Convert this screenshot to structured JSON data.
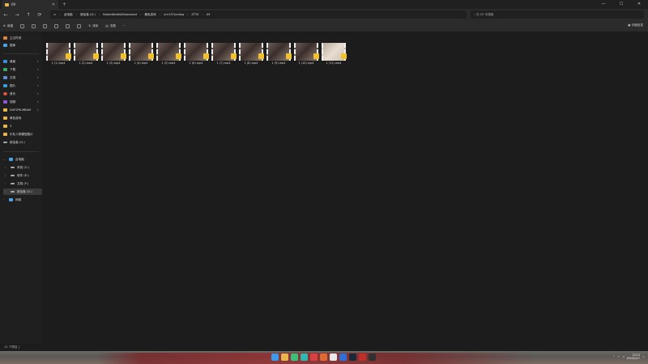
{
  "window": {
    "tab_title": "09",
    "new_tab": "+",
    "controls": [
      "—",
      "☐",
      "✕"
    ]
  },
  "nav": {
    "back": "←",
    "forward": "→",
    "up": "↑",
    "refresh": "⟳"
  },
  "breadcrumb": [
    "此电脑",
    "新加卷 (G:)",
    "BaiduNetdiskDownload",
    "黄色游戏",
    "uhr197yndwg",
    "ZTT4",
    "09"
  ],
  "search": {
    "placeholder": "在 09 中搜索"
  },
  "toolbar": {
    "new_label": "新建",
    "sort_label": "排序",
    "view_label": "查看",
    "more_label": "···",
    "details_label": "详细信息"
  },
  "sidebar": {
    "quick": [
      {
        "label": "主文件夹",
        "icon": "home-icon",
        "color": "#e0833e"
      },
      {
        "label": "图库",
        "icon": "gallery-icon",
        "color": "#4aa3e8"
      }
    ],
    "pinned": [
      {
        "label": "桌面",
        "icon": "desktop-icon",
        "color": "#3b8fd9"
      },
      {
        "label": "下载",
        "icon": "download-icon",
        "color": "#3aa86a"
      },
      {
        "label": "文档",
        "icon": "document-icon",
        "color": "#5a8fd6"
      },
      {
        "label": "图片",
        "icon": "picture-icon",
        "color": "#3b9bd9"
      },
      {
        "label": "音乐",
        "icon": "music-icon",
        "color": "#e0553e"
      },
      {
        "label": "视频",
        "icon": "video-icon",
        "color": "#8b5ad6"
      },
      {
        "label": "DXFSPK-MRAM",
        "icon": "folder-icon",
        "color": "#e8b64c"
      },
      {
        "label": "黄色游戏",
        "icon": "folder-icon",
        "color": "#e8b64c"
      },
      {
        "label": "3",
        "icon": "folder-icon",
        "color": "#e8b64c"
      },
      {
        "label": "乐队人物模型图片",
        "icon": "folder-icon",
        "color": "#e8b64c"
      },
      {
        "label": "新加卷 (G:)",
        "icon": "drive-icon",
        "color": "#aaaaaa"
      }
    ],
    "this_pc": {
      "label": "此电脑",
      "icon": "computer-icon",
      "color": "#4aa3e8"
    },
    "drives": [
      {
        "label": "系统 (C:)",
        "icon": "drive-icon"
      },
      {
        "label": "软件 (E:)",
        "icon": "drive-icon"
      },
      {
        "label": "文档 (F:)",
        "icon": "drive-icon"
      },
      {
        "label": "新加卷 (G:)",
        "icon": "drive-icon"
      }
    ],
    "network": {
      "label": "网络",
      "icon": "network-icon",
      "color": "#4aa3e8"
    }
  },
  "files": [
    {
      "name": "1 (1).mp4",
      "thumb": "dark"
    },
    {
      "name": "1 (2).mp4",
      "thumb": "dark"
    },
    {
      "name": "1 (3).mp4",
      "thumb": "dark"
    },
    {
      "name": "1 (4).mp4",
      "thumb": "dark"
    },
    {
      "name": "1 (5).mp4",
      "thumb": "dark"
    },
    {
      "name": "1 (6).mp4",
      "thumb": "dark"
    },
    {
      "name": "1 (7).mp4",
      "thumb": "dark"
    },
    {
      "name": "1 (8).mp4",
      "thumb": "dark"
    },
    {
      "name": "1 (9).mp4",
      "thumb": "dark"
    },
    {
      "name": "1 (10).mp4",
      "thumb": "dark"
    },
    {
      "name": "1 (11).mp4",
      "thumb": "light"
    }
  ],
  "status": {
    "count": "11 个项目"
  },
  "taskbar": {
    "apps": [
      {
        "name": "start-icon",
        "color": "#3b9be8"
      },
      {
        "name": "file-explorer-icon",
        "color": "#e8b64c"
      },
      {
        "name": "app-green-icon",
        "color": "#3ac07a"
      },
      {
        "name": "app-teal-icon",
        "color": "#2fb8b0"
      },
      {
        "name": "app-red-icon",
        "color": "#d94040"
      },
      {
        "name": "app-orange-icon",
        "color": "#e06a30"
      },
      {
        "name": "app-white-icon",
        "color": "#e8e8e8"
      },
      {
        "name": "app-blue-icon",
        "color": "#2f6fd9"
      },
      {
        "name": "steam-icon",
        "color": "#1b2838"
      },
      {
        "name": "app-red2-icon",
        "color": "#c0302a"
      },
      {
        "name": "app-dark-icon",
        "color": "#303030"
      }
    ],
    "time": "22:13",
    "date": "2024/1/17"
  }
}
